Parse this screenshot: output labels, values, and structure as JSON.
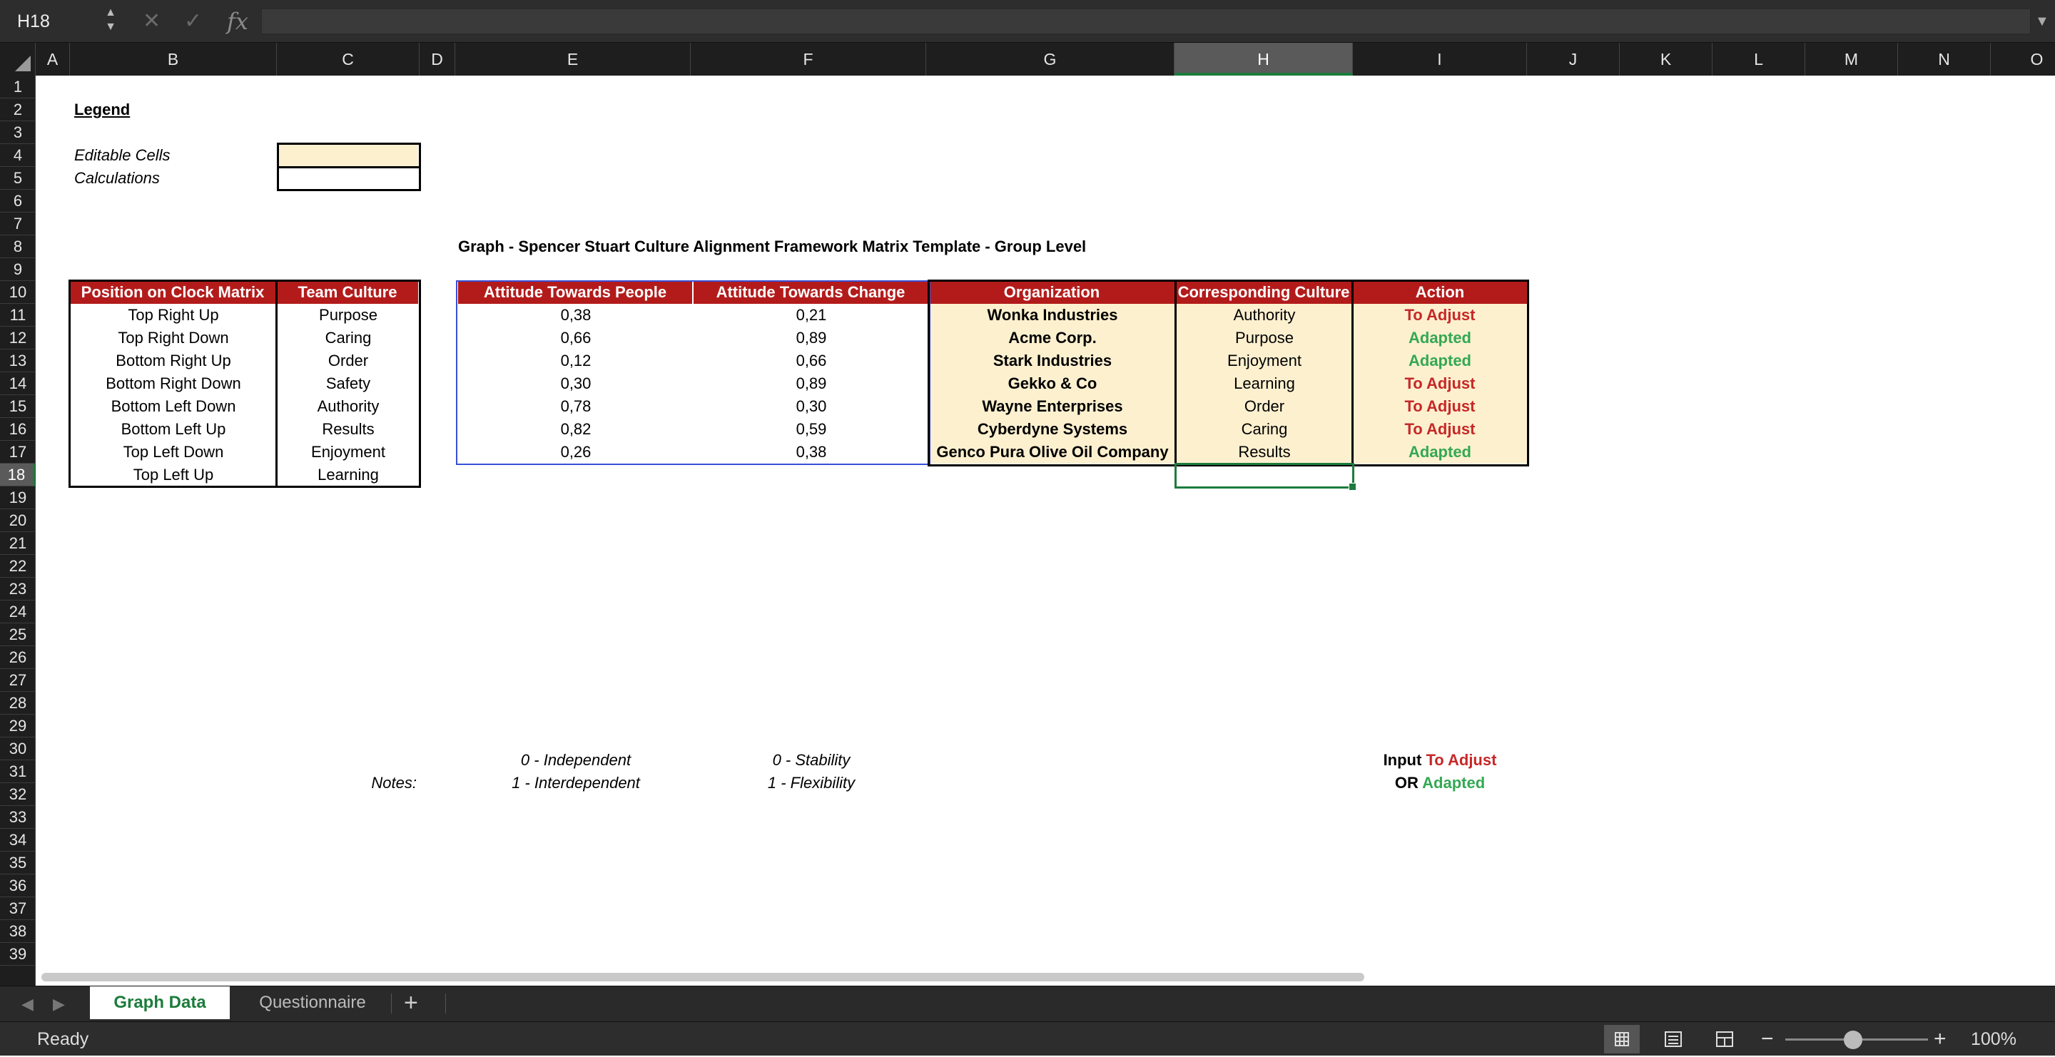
{
  "formula_bar": {
    "name_box": "H18",
    "formula": ""
  },
  "columns": [
    "A",
    "B",
    "C",
    "D",
    "E",
    "F",
    "G",
    "H",
    "I",
    "J",
    "K",
    "L",
    "M",
    "N",
    "O"
  ],
  "rows": [
    "1",
    "2",
    "3",
    "4",
    "5",
    "6",
    "7",
    "8",
    "9",
    "10",
    "11",
    "12",
    "13",
    "14",
    "15",
    "16",
    "17",
    "18",
    "19",
    "20",
    "21",
    "22",
    "23",
    "24",
    "25",
    "26",
    "27",
    "28",
    "29",
    "30",
    "31",
    "32",
    "33",
    "34",
    "35",
    "36",
    "37",
    "38",
    "39"
  ],
  "legend": {
    "title": "Legend",
    "editable": "Editable Cells",
    "calculations": "Calculations"
  },
  "graph_title": "Graph - Spencer Stuart Culture Alignment Framework Matrix Template - Group Level",
  "clock_table": {
    "headers": [
      "Position on Clock Matrix",
      "Team Culture"
    ],
    "rows": [
      [
        "Top Right Up",
        "Purpose"
      ],
      [
        "Top Right Down",
        "Caring"
      ],
      [
        "Bottom Right Up",
        "Order"
      ],
      [
        "Bottom Right Down",
        "Safety"
      ],
      [
        "Bottom Left Down",
        "Authority"
      ],
      [
        "Bottom Left Up",
        "Results"
      ],
      [
        "Top Left Down",
        "Enjoyment"
      ],
      [
        "Top Left Up",
        "Learning"
      ]
    ]
  },
  "data_table": {
    "headers": [
      "Attitude Towards People",
      "Attitude Towards Change",
      "Organization",
      "Corresponding Culture",
      "Action"
    ],
    "rows": [
      [
        "0,38",
        "0,21",
        "Wonka Industries",
        "Authority",
        "To Adjust"
      ],
      [
        "0,66",
        "0,89",
        "Acme Corp.",
        "Purpose",
        "Adapted"
      ],
      [
        "0,12",
        "0,66",
        "Stark Industries",
        "Enjoyment",
        "Adapted"
      ],
      [
        "0,30",
        "0,89",
        "Gekko & Co",
        "Learning",
        "To Adjust"
      ],
      [
        "0,78",
        "0,30",
        "Wayne Enterprises",
        "Order",
        "To Adjust"
      ],
      [
        "0,82",
        "0,59",
        "Cyberdyne Systems",
        "Caring",
        "To Adjust"
      ],
      [
        "0,26",
        "0,38",
        "Genco Pura Olive Oil Company",
        "Results",
        "Adapted"
      ]
    ]
  },
  "notes": {
    "label": "Notes:",
    "people_0": "0 - Independent",
    "people_1": "1 - Interdependent",
    "change_0": "0 - Stability",
    "change_1": "1 - Flexibility",
    "input_label": "Input",
    "input_to_adjust": "To Adjust",
    "or_label": "OR",
    "or_adapted": "Adapted"
  },
  "sheet_tabs": {
    "active": "Graph Data",
    "other": "Questionnaire",
    "add": "+"
  },
  "status_bar": {
    "status": "Ready",
    "zoom": "100%"
  },
  "colors": {
    "header_red": "#b31b1b",
    "editable_fill": "#fdf0cf",
    "to_adjust": "#c62828",
    "adapted": "#34a853",
    "selection_green": "#1c7c3c"
  }
}
